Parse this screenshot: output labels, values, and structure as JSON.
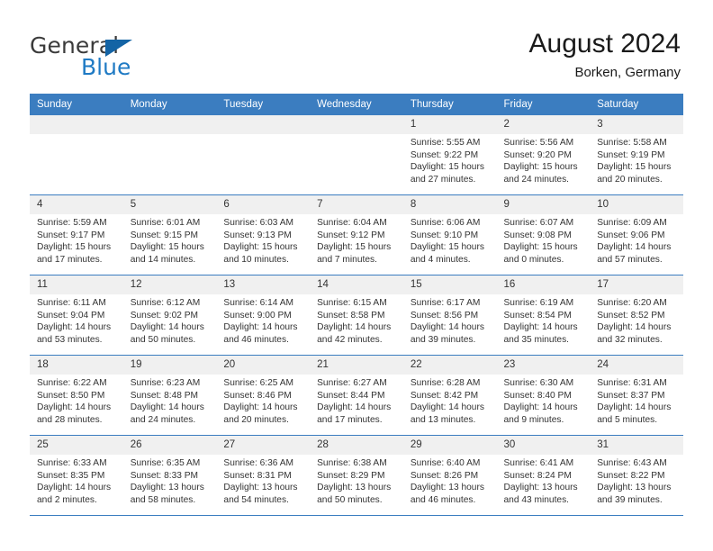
{
  "brand": {
    "name_part1": "General",
    "name_part2": "Blue",
    "triangle_icon": "blue-triangle-logo-mark"
  },
  "header": {
    "title": "August 2024",
    "subtitle": "Borken, Germany"
  },
  "colors": {
    "header_blue": "#3b7dc0",
    "date_band_gray": "#f0f0f0",
    "brand_blue": "#1f7ac4",
    "text": "#333333"
  },
  "calendar": {
    "weekday_headers": [
      "Sunday",
      "Monday",
      "Tuesday",
      "Wednesday",
      "Thursday",
      "Friday",
      "Saturday"
    ],
    "weeks": [
      [
        {
          "day": "",
          "empty": true,
          "sunrise": "",
          "sunset": "",
          "daylight1": "",
          "daylight2": ""
        },
        {
          "day": "",
          "empty": true,
          "sunrise": "",
          "sunset": "",
          "daylight1": "",
          "daylight2": ""
        },
        {
          "day": "",
          "empty": true,
          "sunrise": "",
          "sunset": "",
          "daylight1": "",
          "daylight2": ""
        },
        {
          "day": "",
          "empty": true,
          "sunrise": "",
          "sunset": "",
          "daylight1": "",
          "daylight2": ""
        },
        {
          "day": "1",
          "empty": false,
          "sunrise": "Sunrise: 5:55 AM",
          "sunset": "Sunset: 9:22 PM",
          "daylight1": "Daylight: 15 hours",
          "daylight2": "and 27 minutes."
        },
        {
          "day": "2",
          "empty": false,
          "sunrise": "Sunrise: 5:56 AM",
          "sunset": "Sunset: 9:20 PM",
          "daylight1": "Daylight: 15 hours",
          "daylight2": "and 24 minutes."
        },
        {
          "day": "3",
          "empty": false,
          "sunrise": "Sunrise: 5:58 AM",
          "sunset": "Sunset: 9:19 PM",
          "daylight1": "Daylight: 15 hours",
          "daylight2": "and 20 minutes."
        }
      ],
      [
        {
          "day": "4",
          "empty": false,
          "sunrise": "Sunrise: 5:59 AM",
          "sunset": "Sunset: 9:17 PM",
          "daylight1": "Daylight: 15 hours",
          "daylight2": "and 17 minutes."
        },
        {
          "day": "5",
          "empty": false,
          "sunrise": "Sunrise: 6:01 AM",
          "sunset": "Sunset: 9:15 PM",
          "daylight1": "Daylight: 15 hours",
          "daylight2": "and 14 minutes."
        },
        {
          "day": "6",
          "empty": false,
          "sunrise": "Sunrise: 6:03 AM",
          "sunset": "Sunset: 9:13 PM",
          "daylight1": "Daylight: 15 hours",
          "daylight2": "and 10 minutes."
        },
        {
          "day": "7",
          "empty": false,
          "sunrise": "Sunrise: 6:04 AM",
          "sunset": "Sunset: 9:12 PM",
          "daylight1": "Daylight: 15 hours",
          "daylight2": "and 7 minutes."
        },
        {
          "day": "8",
          "empty": false,
          "sunrise": "Sunrise: 6:06 AM",
          "sunset": "Sunset: 9:10 PM",
          "daylight1": "Daylight: 15 hours",
          "daylight2": "and 4 minutes."
        },
        {
          "day": "9",
          "empty": false,
          "sunrise": "Sunrise: 6:07 AM",
          "sunset": "Sunset: 9:08 PM",
          "daylight1": "Daylight: 15 hours",
          "daylight2": "and 0 minutes."
        },
        {
          "day": "10",
          "empty": false,
          "sunrise": "Sunrise: 6:09 AM",
          "sunset": "Sunset: 9:06 PM",
          "daylight1": "Daylight: 14 hours",
          "daylight2": "and 57 minutes."
        }
      ],
      [
        {
          "day": "11",
          "empty": false,
          "sunrise": "Sunrise: 6:11 AM",
          "sunset": "Sunset: 9:04 PM",
          "daylight1": "Daylight: 14 hours",
          "daylight2": "and 53 minutes."
        },
        {
          "day": "12",
          "empty": false,
          "sunrise": "Sunrise: 6:12 AM",
          "sunset": "Sunset: 9:02 PM",
          "daylight1": "Daylight: 14 hours",
          "daylight2": "and 50 minutes."
        },
        {
          "day": "13",
          "empty": false,
          "sunrise": "Sunrise: 6:14 AM",
          "sunset": "Sunset: 9:00 PM",
          "daylight1": "Daylight: 14 hours",
          "daylight2": "and 46 minutes."
        },
        {
          "day": "14",
          "empty": false,
          "sunrise": "Sunrise: 6:15 AM",
          "sunset": "Sunset: 8:58 PM",
          "daylight1": "Daylight: 14 hours",
          "daylight2": "and 42 minutes."
        },
        {
          "day": "15",
          "empty": false,
          "sunrise": "Sunrise: 6:17 AM",
          "sunset": "Sunset: 8:56 PM",
          "daylight1": "Daylight: 14 hours",
          "daylight2": "and 39 minutes."
        },
        {
          "day": "16",
          "empty": false,
          "sunrise": "Sunrise: 6:19 AM",
          "sunset": "Sunset: 8:54 PM",
          "daylight1": "Daylight: 14 hours",
          "daylight2": "and 35 minutes."
        },
        {
          "day": "17",
          "empty": false,
          "sunrise": "Sunrise: 6:20 AM",
          "sunset": "Sunset: 8:52 PM",
          "daylight1": "Daylight: 14 hours",
          "daylight2": "and 32 minutes."
        }
      ],
      [
        {
          "day": "18",
          "empty": false,
          "sunrise": "Sunrise: 6:22 AM",
          "sunset": "Sunset: 8:50 PM",
          "daylight1": "Daylight: 14 hours",
          "daylight2": "and 28 minutes."
        },
        {
          "day": "19",
          "empty": false,
          "sunrise": "Sunrise: 6:23 AM",
          "sunset": "Sunset: 8:48 PM",
          "daylight1": "Daylight: 14 hours",
          "daylight2": "and 24 minutes."
        },
        {
          "day": "20",
          "empty": false,
          "sunrise": "Sunrise: 6:25 AM",
          "sunset": "Sunset: 8:46 PM",
          "daylight1": "Daylight: 14 hours",
          "daylight2": "and 20 minutes."
        },
        {
          "day": "21",
          "empty": false,
          "sunrise": "Sunrise: 6:27 AM",
          "sunset": "Sunset: 8:44 PM",
          "daylight1": "Daylight: 14 hours",
          "daylight2": "and 17 minutes."
        },
        {
          "day": "22",
          "empty": false,
          "sunrise": "Sunrise: 6:28 AM",
          "sunset": "Sunset: 8:42 PM",
          "daylight1": "Daylight: 14 hours",
          "daylight2": "and 13 minutes."
        },
        {
          "day": "23",
          "empty": false,
          "sunrise": "Sunrise: 6:30 AM",
          "sunset": "Sunset: 8:40 PM",
          "daylight1": "Daylight: 14 hours",
          "daylight2": "and 9 minutes."
        },
        {
          "day": "24",
          "empty": false,
          "sunrise": "Sunrise: 6:31 AM",
          "sunset": "Sunset: 8:37 PM",
          "daylight1": "Daylight: 14 hours",
          "daylight2": "and 5 minutes."
        }
      ],
      [
        {
          "day": "25",
          "empty": false,
          "sunrise": "Sunrise: 6:33 AM",
          "sunset": "Sunset: 8:35 PM",
          "daylight1": "Daylight: 14 hours",
          "daylight2": "and 2 minutes."
        },
        {
          "day": "26",
          "empty": false,
          "sunrise": "Sunrise: 6:35 AM",
          "sunset": "Sunset: 8:33 PM",
          "daylight1": "Daylight: 13 hours",
          "daylight2": "and 58 minutes."
        },
        {
          "day": "27",
          "empty": false,
          "sunrise": "Sunrise: 6:36 AM",
          "sunset": "Sunset: 8:31 PM",
          "daylight1": "Daylight: 13 hours",
          "daylight2": "and 54 minutes."
        },
        {
          "day": "28",
          "empty": false,
          "sunrise": "Sunrise: 6:38 AM",
          "sunset": "Sunset: 8:29 PM",
          "daylight1": "Daylight: 13 hours",
          "daylight2": "and 50 minutes."
        },
        {
          "day": "29",
          "empty": false,
          "sunrise": "Sunrise: 6:40 AM",
          "sunset": "Sunset: 8:26 PM",
          "daylight1": "Daylight: 13 hours",
          "daylight2": "and 46 minutes."
        },
        {
          "day": "30",
          "empty": false,
          "sunrise": "Sunrise: 6:41 AM",
          "sunset": "Sunset: 8:24 PM",
          "daylight1": "Daylight: 13 hours",
          "daylight2": "and 43 minutes."
        },
        {
          "day": "31",
          "empty": false,
          "sunrise": "Sunrise: 6:43 AM",
          "sunset": "Sunset: 8:22 PM",
          "daylight1": "Daylight: 13 hours",
          "daylight2": "and 39 minutes."
        }
      ]
    ]
  }
}
